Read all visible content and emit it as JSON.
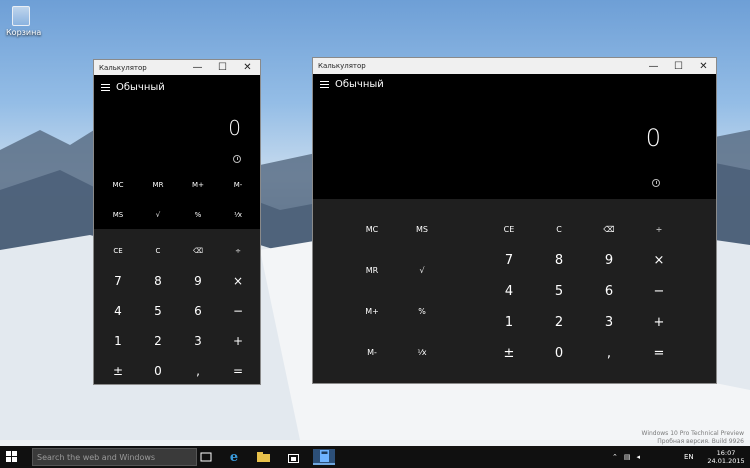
{
  "desktop": {
    "recycle_bin_label": "Корзина",
    "watermark_line1": "Windows 10 Pro Technical Preview",
    "watermark_line2": "Пробная версия. Build 9926"
  },
  "small_calc": {
    "title": "Калькулятор",
    "mode": "Обычный",
    "display_value": "0",
    "memory_row1": [
      "MC",
      "MR",
      "M+",
      "M-"
    ],
    "memory_row2": [
      "MS",
      "√",
      "%",
      "¹⁄x"
    ],
    "keys": [
      [
        "CE",
        "C",
        "⌫",
        "÷"
      ],
      [
        "7",
        "8",
        "9",
        "×"
      ],
      [
        "4",
        "5",
        "6",
        "−"
      ],
      [
        "1",
        "2",
        "3",
        "+"
      ],
      [
        "±",
        "0",
        ",",
        "="
      ]
    ]
  },
  "large_calc": {
    "title": "Калькулятор",
    "mode": "Обычный",
    "display_value": "0",
    "memory_keys": [
      [
        "MC",
        "MS"
      ],
      [
        "MR",
        "√"
      ],
      [
        "M+",
        "%"
      ],
      [
        "M-",
        "¹⁄x"
      ]
    ],
    "keys": [
      [
        "CE",
        "C",
        "⌫",
        "÷"
      ],
      [
        "7",
        "8",
        "9",
        "×"
      ],
      [
        "4",
        "5",
        "6",
        "−"
      ],
      [
        "1",
        "2",
        "3",
        "+"
      ],
      [
        "±",
        "0",
        ",",
        "="
      ]
    ]
  },
  "window_controls": {
    "minimize": "—",
    "maximize": "☐",
    "close": "✕"
  },
  "taskbar": {
    "search_placeholder": "Search the web and Windows",
    "language": "EN",
    "time": "16:07",
    "date": "24.01.2015",
    "accent": "#2c4f78"
  }
}
